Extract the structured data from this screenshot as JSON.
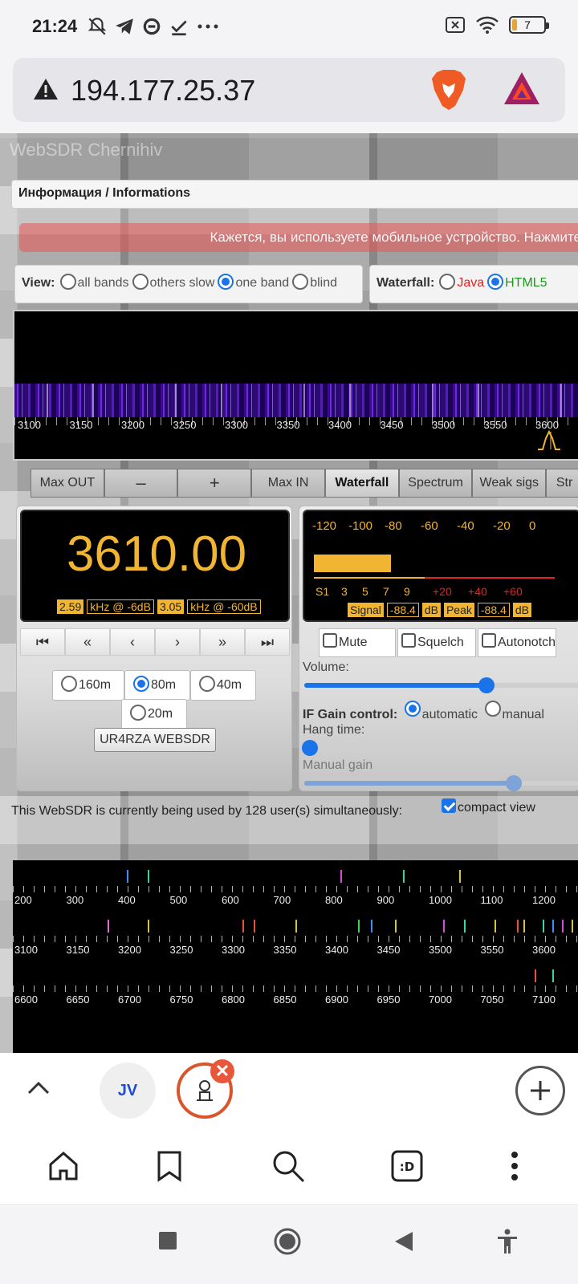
{
  "status": {
    "time": "21:24",
    "battery": "7"
  },
  "address": {
    "url": "194.177.25.37"
  },
  "page": {
    "site_title": "WebSDR Chernihiv",
    "info_bar": "Информация / Informations",
    "mobile_banner": "Кажется, вы используете мобильное устройство. Нажмите",
    "view": {
      "label": "View:",
      "options": [
        "all bands",
        "others slow",
        "one band",
        "blind"
      ],
      "selected": "one band"
    },
    "waterfall": {
      "label": "Waterfall:",
      "options": [
        "Java",
        "HTML5"
      ],
      "selected": "HTML5",
      "axis": [
        "3100",
        "3150",
        "3200",
        "3250",
        "3300",
        "3350",
        "3400",
        "3450",
        "3500",
        "3550",
        "3600"
      ]
    },
    "controls": [
      "Max OUT",
      "–",
      "+",
      "Max IN",
      "Waterfall",
      "Spectrum",
      "Weak sigs",
      "Str"
    ],
    "active_control": "Waterfall",
    "frequency": {
      "value": "3610.00",
      "bw1": "2.59",
      "bw1_text": "kHz @ -6dB",
      "bw2": "3.05",
      "bw2_text": "kHz @ -60dB"
    },
    "tuning": [
      "⏮",
      "«",
      "‹",
      "›",
      "»",
      "⏭"
    ],
    "bands": [
      "160m",
      "80m",
      "40m",
      "20m"
    ],
    "selected_band": "80m",
    "station_button": "UR4RZA WEBSDR",
    "meter": {
      "scale_top": [
        "-120",
        "-100",
        "-80",
        "-60",
        "-40",
        "-20",
        "0"
      ],
      "scale_bottom": [
        "S1",
        "3",
        "5",
        "7",
        "9",
        "+20",
        "+40",
        "+60"
      ],
      "signal_label": "Signal",
      "signal_value": "-88.4",
      "signal_unit": "dB",
      "peak_label": "Peak",
      "peak_value": "-88.4",
      "peak_unit": "dB",
      "level_fraction": 0.29
    },
    "toggles": [
      "Mute",
      "Squelch",
      "Autonotch"
    ],
    "volume": {
      "label": "Volume:",
      "level": 0.66
    },
    "if_gain": {
      "label": "IF Gain control:",
      "options": [
        "automatic",
        "manual"
      ],
      "selected": "automatic"
    },
    "hang_time": {
      "label": "Hang time:",
      "level": 0.02
    },
    "manual_gain": {
      "label": "Manual gain",
      "level": 0.76
    },
    "users_text": "This WebSDR is currently being used by 128 user(s) simultaneously:",
    "compact_view": "compact view",
    "bands_overview": {
      "row1": [
        "200",
        "300",
        "400",
        "500",
        "600",
        "700",
        "800",
        "900",
        "1000",
        "1100",
        "1200"
      ],
      "row2": [
        "3100",
        "3150",
        "3200",
        "3250",
        "3300",
        "3350",
        "3400",
        "3450",
        "3500",
        "3550",
        "3600"
      ],
      "row3": [
        "6600",
        "6650",
        "6700",
        "6750",
        "6800",
        "6850",
        "6900",
        "6950",
        "7000",
        "7050",
        "7100"
      ]
    }
  },
  "browser": {
    "tab1_badge": "JV",
    "close_symbol": "✕"
  },
  "colors": {
    "accent": "#1a73e8",
    "display_amber": "#f2b531",
    "tab_active": "#d9552c"
  }
}
